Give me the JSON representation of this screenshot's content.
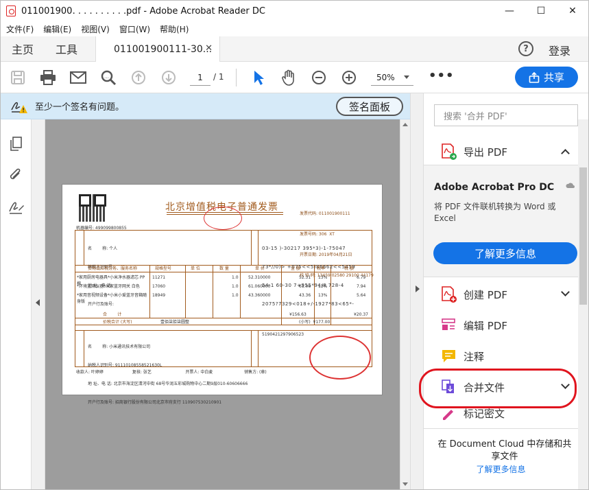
{
  "window": {
    "title": "011001900․ . . . . . . . . .pdf - Adobe Acrobat Reader DC",
    "minimize": "—",
    "maximize": "☐",
    "close": "✕"
  },
  "menu": [
    "文件(F)",
    "编辑(E)",
    "视图(V)",
    "窗口(W)",
    "帮助(H)"
  ],
  "tabs": {
    "home": "主页",
    "tools": "工具",
    "doc_tab": "011001900111-30...",
    "help": "?",
    "login": "登录"
  },
  "toolbar": {
    "page_current": "1",
    "page_total": "/ 1",
    "zoom": "50%",
    "more": "•••",
    "share": "共享"
  },
  "notice": {
    "text": "至少一个签名有问题。",
    "button": "签名面板"
  },
  "invoice": {
    "title": "北京增值税电子普通发票",
    "machine_no": "机器编号: 499099800855",
    "meta": [
      "发票代码: 011001900111",
      "发票号码: 306  XT",
      "开票日期: 2019年04月21日",
      "校 验 码: 13459 02580 29100 44179"
    ],
    "buyer": [
      "名        称: 个人",
      "纳税人识别号:",
      "地 址、电 话:",
      "开户行及账号:"
    ],
    "cipher": [
      "03-15 )-30217 395*3)-1-75047",
      "73*//0)> +075<<5)86662<<5459",
      "54-1 60-30 7+955*94/8 728-4",
      "2075?7329<018+/-1927*83<65*-"
    ],
    "headers": [
      "货物或应税劳务、服务名称",
      "规格型号",
      "单 位",
      "数 量",
      "单 价",
      "金 额",
      "税率",
      "税 额"
    ],
    "rows": [
      [
        "*家用厨房电器具*小米净水器滤芯 PP棉",
        "11271",
        "",
        "1.0",
        "52.310000",
        "52.31",
        "13%",
        "6.79"
      ],
      [
        "*环境监测仪器*米家蓝牙网关 白色",
        "17060",
        "",
        "1.0",
        "61.060000",
        "61.06",
        "13%",
        "7.94"
      ],
      [
        "*家用音视频设备*小米小爱蓝牙音箱随身版",
        "18949",
        "",
        "1.0",
        "43.360000",
        "43.36",
        "13%",
        "5.64"
      ]
    ],
    "subtotal_label": "合        计",
    "subtotal_amount": "¥156.63",
    "subtotal_tax": "¥20.37",
    "total_label": "价税合计 (大写)",
    "total_words": "壹佰柒拾柒圆整",
    "total_small": "(小写)  ¥177.00",
    "seller": [
      "名        称: 小米通讯技术有限公司",
      "纳税人识别号: 91110108558521630L",
      "地 址、电 话: 北京市海淀区清河中街 68号华润五彩城购物中心二期9层010-60606666",
      "开户行及账号: 招商银行股份有限公司北京市府支行 110907530210901"
    ],
    "remark": "5190421297906523",
    "footer": "收款人: 叶婷婷                      复核: 张艺                          开票人: 中白麦                        销售方: (章)"
  },
  "right_panel": {
    "search_placeholder": "搜索 '合并 PDF'",
    "export_pdf": "导出 PDF",
    "promo_title": "Adobe Acrobat Pro DC",
    "promo_text": "将 PDF 文件联机转换为 Word 或 Excel",
    "promo_button": "了解更多信息",
    "create_pdf": "创建 PDF",
    "edit_pdf": "编辑 PDF",
    "comment": "注释",
    "combine": "合并文件",
    "redact": "标记密文",
    "cloud_text": "在 Document Cloud 中存储和共享文件",
    "cloud_link": "了解更多信息"
  },
  "colors": {
    "accent": "#1473e6",
    "notice_bg": "#d6eaf8",
    "highlight_ring": "#e0141e",
    "invoice_brown": "#a15a1c"
  }
}
